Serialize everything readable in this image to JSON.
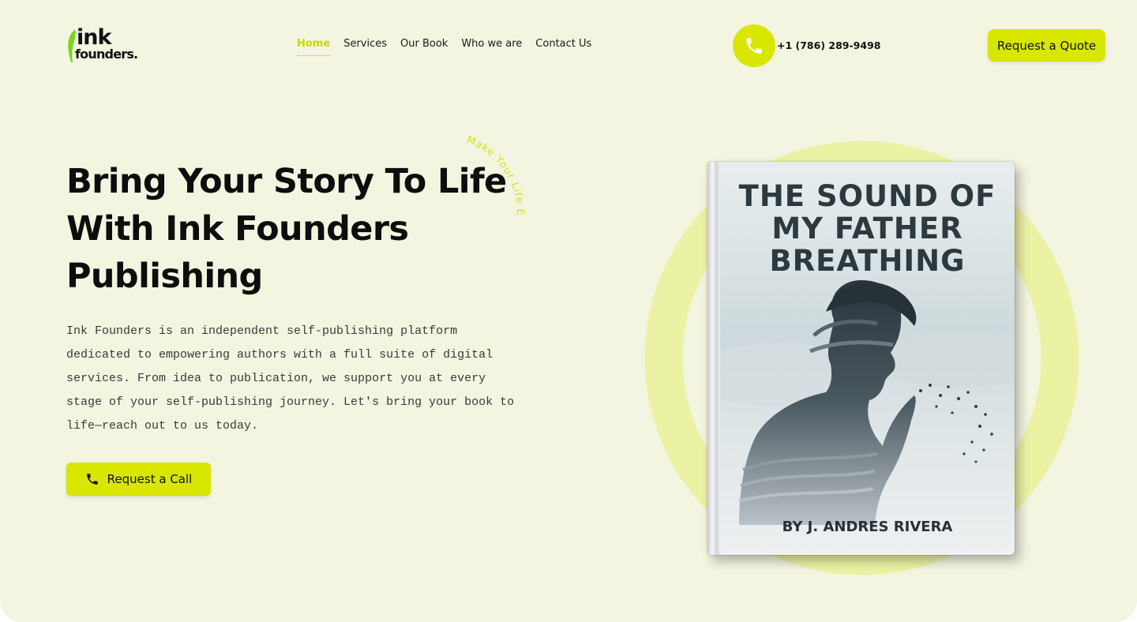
{
  "brand": {
    "logo_line1": "ink",
    "logo_line2": "founders.",
    "accent_color": "#d8e600",
    "background_color": "#f3f5e1"
  },
  "nav": {
    "items": [
      {
        "label": "Home",
        "active": true
      },
      {
        "label": "Services",
        "active": false
      },
      {
        "label": "Our Book",
        "active": false
      },
      {
        "label": "Who we are",
        "active": false
      },
      {
        "label": "Contact Us",
        "active": false
      }
    ]
  },
  "header": {
    "phone_icon": "phone-icon",
    "phone_number": "+1 (786) 289-9498",
    "quote_button": "Request a Quote"
  },
  "hero": {
    "title": "Bring Your Story To Life With Ink Founders Publishing",
    "curved_text": "Make Your Life Easy",
    "description": "Ink Founders is an independent self-publishing platform dedicated to empowering authors with a full suite of digital services. From idea to publication, we support you at every stage of your self-publishing journey. Let's bring your book to life—reach out to us today.",
    "call_button": "Request a Call",
    "call_icon": "phone-icon"
  },
  "book": {
    "title": "THE SOUND OF MY FATHER BREATHING",
    "author": "BY J. ANDRES RIVERA"
  }
}
